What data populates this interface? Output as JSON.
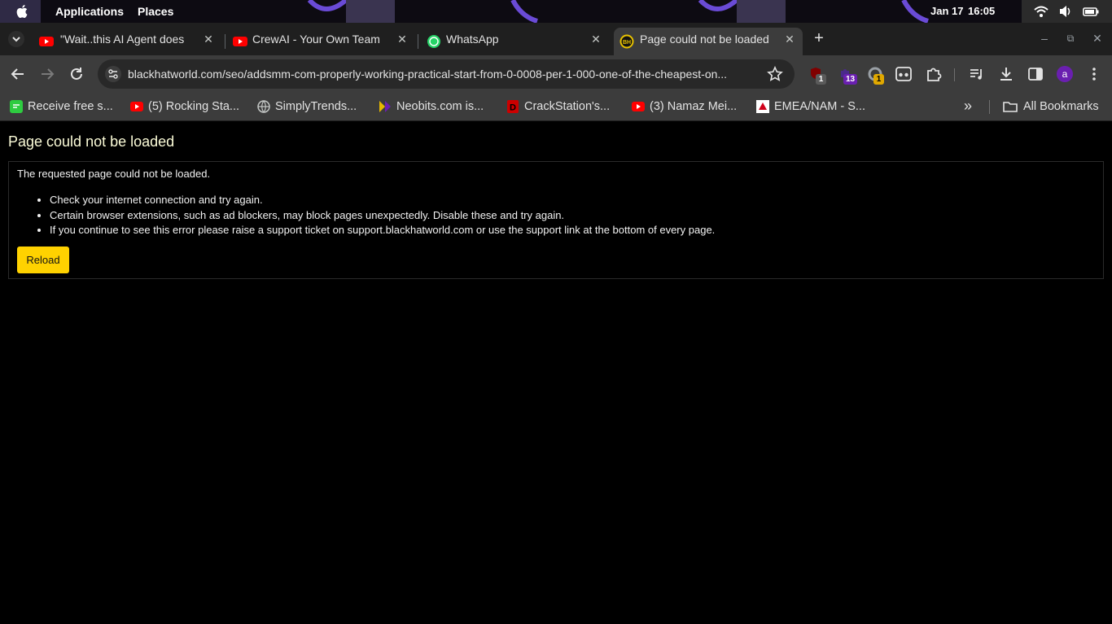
{
  "topbar": {
    "applications_label": "Applications",
    "places_label": "Places",
    "date": "Jan 17",
    "time": "16:05"
  },
  "tabs": [
    {
      "title": "\"Wait..this AI Agent does",
      "favicon": "youtube-icon",
      "active": false
    },
    {
      "title": "CrewAI - Your Own Team",
      "favicon": "youtube-icon",
      "active": false
    },
    {
      "title": "WhatsApp",
      "favicon": "whatsapp-icon",
      "active": false
    },
    {
      "title": "Page could not be loaded",
      "favicon": "blackhatworld-icon",
      "active": true
    }
  ],
  "address_bar": {
    "url": "blackhatworld.com/seo/addsmm-com-properly-working-practical-start-from-0-0008-per-1-000-one-of-the-cheapest-on..."
  },
  "extensions": {
    "ublock_count": "1",
    "ext2_count": "13",
    "ext3_count": "1"
  },
  "profile": {
    "initial": "a"
  },
  "bookmarks": [
    {
      "label": "Receive free s...",
      "icon": "chat-icon"
    },
    {
      "label": "(5) Rocking Sta...",
      "icon": "youtube-icon"
    },
    {
      "label": "SimplyTrends...",
      "icon": "globe-icon"
    },
    {
      "label": "Neobits.com is...",
      "icon": "neobits-icon"
    },
    {
      "label": "CrackStation's...",
      "icon": "crackstation-icon"
    },
    {
      "label": "(3) Namaz Mei...",
      "icon": "youtube-icon"
    },
    {
      "label": "EMEA/NAM - S...",
      "icon": "triangle-icon"
    }
  ],
  "all_bookmarks_label": "All Bookmarks",
  "page": {
    "title": "Page could not be loaded",
    "message": "The requested page could not be loaded.",
    "items": [
      "Check your internet connection and try again.",
      "Certain browser extensions, such as ad blockers, may block pages unexpectedly. Disable these and try again.",
      "If you continue to see this error please raise a support ticket on support.blackhatworld.com or use the support link at the bottom of every page."
    ],
    "reload_label": "Reload"
  },
  "colors": {
    "reload_button": "#ffd200",
    "title": "#fcfcd8",
    "toolbar": "#3c3c3c",
    "tabstrip": "#1f1f1f"
  }
}
